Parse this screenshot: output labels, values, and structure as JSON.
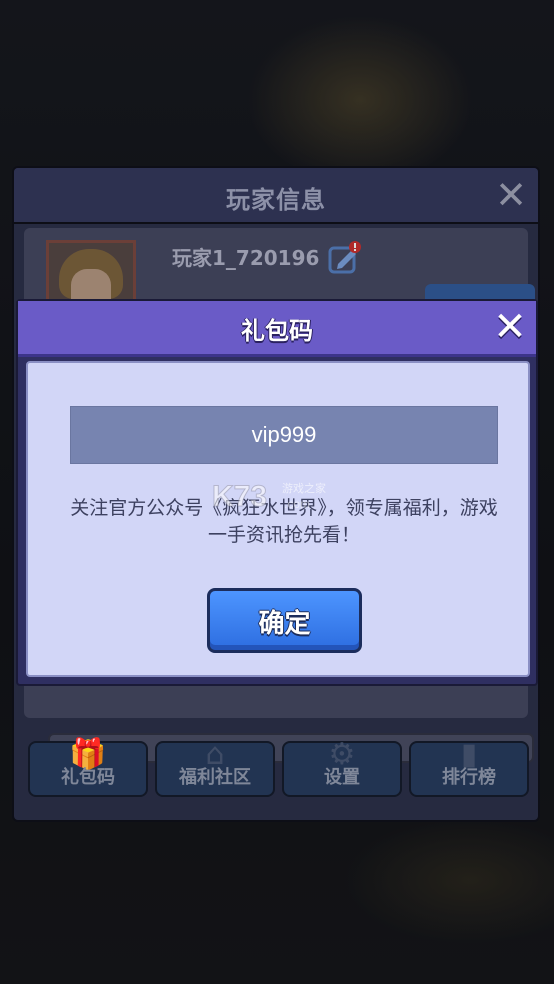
{
  "player_panel": {
    "title": "玩家信息",
    "player_name": "玩家1_720196",
    "nav": [
      {
        "label": "礼包码",
        "icon": "gift-icon"
      },
      {
        "label": "福利社区",
        "icon": "home-icon"
      },
      {
        "label": "设置",
        "icon": "gear-icon"
      },
      {
        "label": "排行榜",
        "icon": "bar-chart-icon"
      }
    ]
  },
  "gift_modal": {
    "title": "礼包码",
    "code_value": "vip999",
    "notice": "关注官方公众号《疯狂水世界》，领专属福利，游戏一手资讯抢先看！",
    "confirm_label": "确定"
  },
  "watermark": {
    "logo": "K73",
    "text": "游戏之家",
    "url": ".com"
  },
  "colors": {
    "modal_header": "#6a5bc7",
    "modal_body": "#d2d6f7",
    "confirm_button": "#3a80f0",
    "code_field": "#7784b0"
  }
}
